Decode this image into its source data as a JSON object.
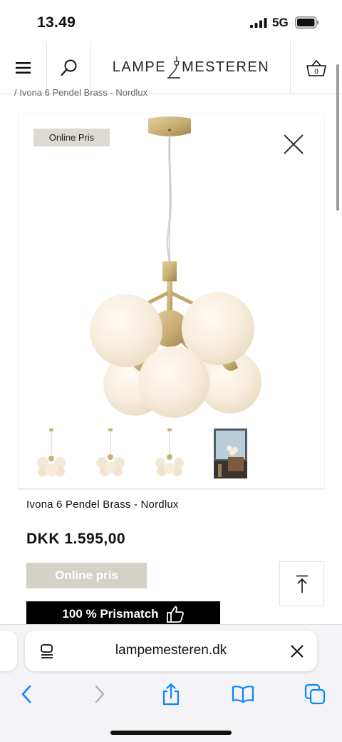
{
  "status_bar": {
    "time": "13.49",
    "network": "5G"
  },
  "header": {
    "logo_left": "LAMPE",
    "logo_right": "MESTEREN",
    "basket_count": "0"
  },
  "breadcrumb": "/ Ivona 6 Pendel Brass - Nordlux",
  "gallery": {
    "badge": "Online Pris"
  },
  "product": {
    "title": "Ivona 6 Pendel Brass - Nordlux",
    "price": "DKK 1.595,00",
    "online_button": "Online pris",
    "prismatch": "100 % Prismatch"
  },
  "browser": {
    "url": "lampemesteren.dk"
  },
  "colors": {
    "brass": "#c9b17a",
    "glass": "#f6ede0",
    "badge_bg": "#dddad2",
    "accent_ios": "#0a84ff"
  }
}
